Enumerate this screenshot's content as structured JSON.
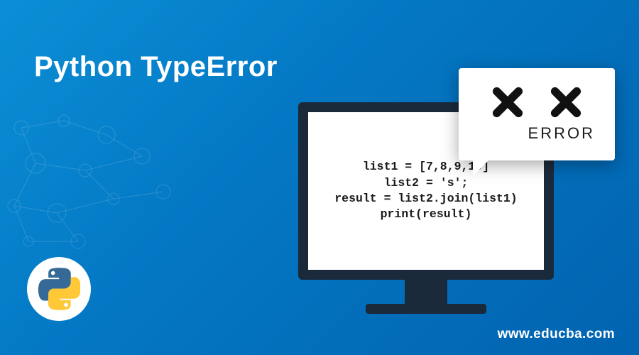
{
  "title": "Python TypeError",
  "error_popup": {
    "label": "ERROR"
  },
  "code": {
    "line1": "list1 = [7,8,9,10]",
    "line2": "list2 = 's';",
    "line3": "result = list2.join(list1)",
    "line4": "print(result)"
  },
  "website": "www.educba.com",
  "logo_name": "python-logo"
}
